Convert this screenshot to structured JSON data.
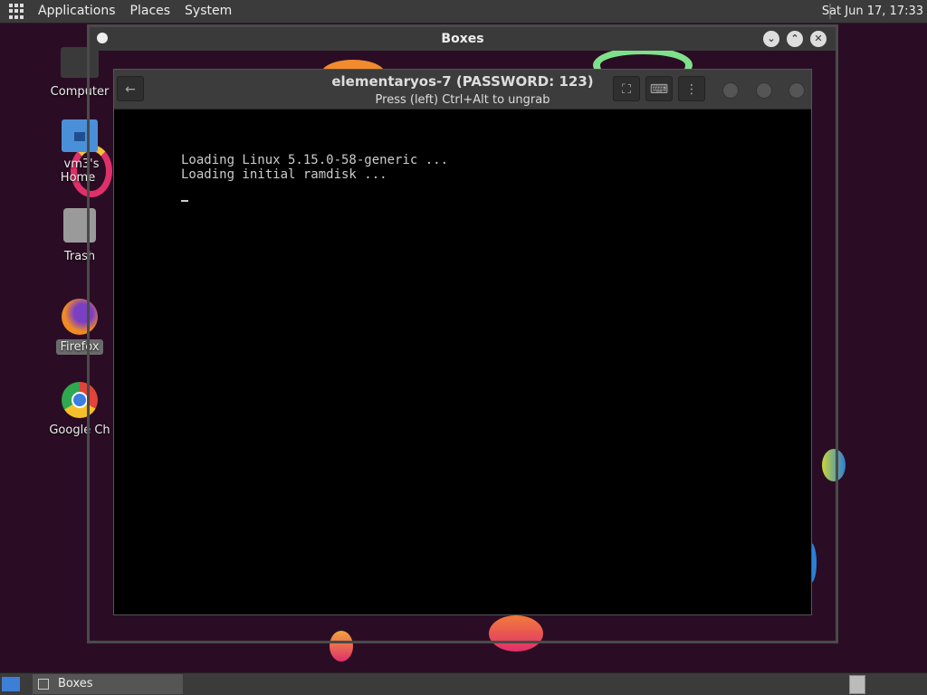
{
  "top_panel": {
    "menus": [
      "Applications",
      "Places",
      "System"
    ],
    "clock": "Sat Jun 17, 17:33"
  },
  "desktop_icons": [
    {
      "label": "Computer"
    },
    {
      "label": "vm3's Home"
    },
    {
      "label": "Trash"
    },
    {
      "label": "Firefox"
    },
    {
      "label": "Google Ch"
    }
  ],
  "boxes_window": {
    "title": "Boxes"
  },
  "vm_window": {
    "title": "elementaryos-7 (PASSWORD: 123)",
    "subtitle": "Press (left) Ctrl+Alt to ungrab",
    "console_lines": [
      "Loading Linux 5.15.0-58-generic ...",
      "Loading initial ramdisk ..."
    ]
  },
  "taskbar": {
    "task_label": "Boxes"
  },
  "colors": {
    "desktop_bg": "#2a0d24",
    "panel_bg": "#3b3b3b",
    "accent_blue": "#3d7fd6"
  }
}
